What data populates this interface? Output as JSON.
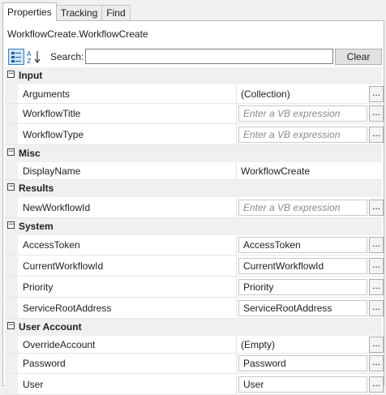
{
  "tabs": [
    "Properties",
    "Tracking",
    "Find"
  ],
  "activity_name": "WorkflowCreate.WorkflowCreate",
  "toolbar": {
    "categorized_icon": "categorized-view-icon",
    "alphabetical_icon": "sort-az-icon",
    "search_label": "Search:",
    "search_value": "",
    "clear_label": "Clear"
  },
  "categories": [
    {
      "title": "Input",
      "props": [
        {
          "name": "Arguments",
          "value": "(Collection)",
          "kind": "plain"
        },
        {
          "name": "WorkflowTitle",
          "value": "Enter a VB expression",
          "kind": "placeholder"
        },
        {
          "name": "WorkflowType",
          "value": "Enter a VB expression",
          "kind": "placeholder"
        }
      ]
    },
    {
      "title": "Misc",
      "props": [
        {
          "name": "DisplayName",
          "value": "WorkflowCreate",
          "kind": "plain-noell"
        }
      ]
    },
    {
      "title": "Results",
      "props": [
        {
          "name": "NewWorkflowId",
          "value": "Enter a VB expression",
          "kind": "placeholder"
        }
      ]
    },
    {
      "title": "System",
      "props": [
        {
          "name": "AccessToken",
          "value": "AccessToken",
          "kind": "value"
        },
        {
          "name": "CurrentWorkflowId",
          "value": "CurrentWorkflowId",
          "kind": "value"
        },
        {
          "name": "Priority",
          "value": "Priority",
          "kind": "value"
        },
        {
          "name": "ServiceRootAddress",
          "value": "ServiceRootAddress",
          "kind": "value"
        }
      ]
    },
    {
      "title": "User Account",
      "props": [
        {
          "name": "OverrideAccount",
          "value": "(Empty)",
          "kind": "plain"
        },
        {
          "name": "Password",
          "value": "Password",
          "kind": "value"
        },
        {
          "name": "User",
          "value": "User",
          "kind": "value"
        }
      ]
    }
  ],
  "ellipsis": "...",
  "collapse_glyph": "−"
}
